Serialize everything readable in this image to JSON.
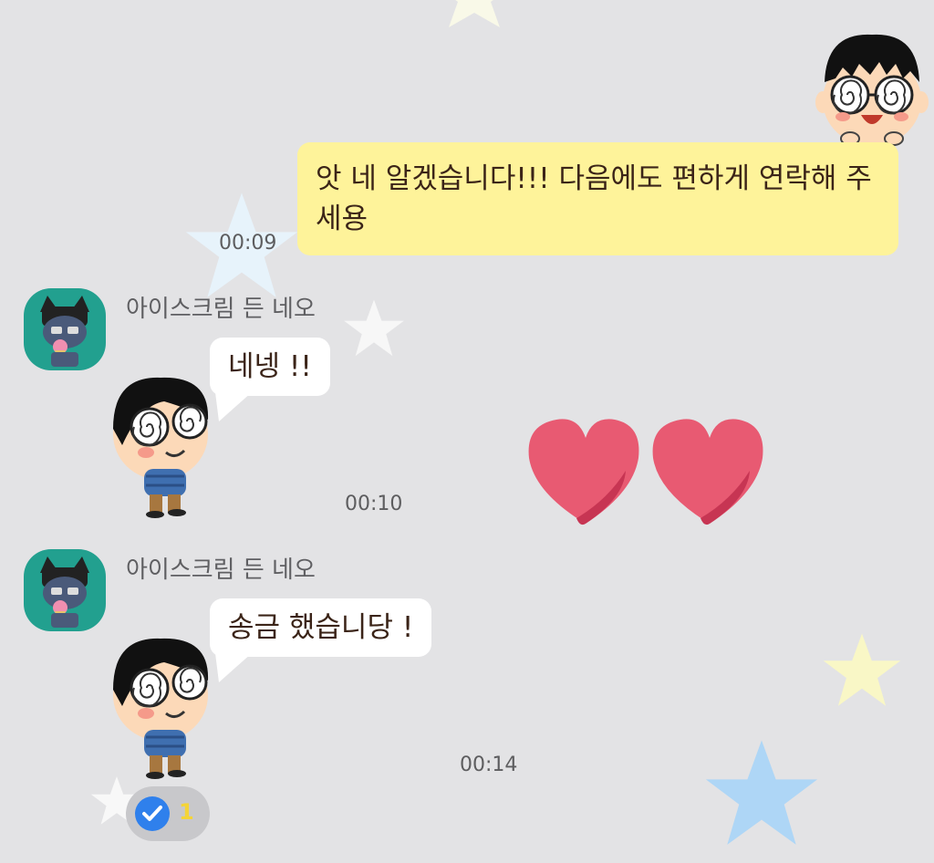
{
  "messages": {
    "outgoing": {
      "text": "앗 네 알겠습니다!!! 다음에도 편하게 연락해 주세용",
      "time": "00:09",
      "emoticon_icon": "spiral-glasses-boy-icon"
    },
    "incoming": [
      {
        "sender": "아이스크림 든 네오",
        "avatar_icon": "neo-cat-with-icecream-icon",
        "text": "네넹 !!",
        "time": "00:10",
        "emoticon_icon": "spiral-glasses-boy-icon"
      },
      {
        "sender": "아이스크림 든 네오",
        "avatar_icon": "neo-cat-with-icecream-icon",
        "text": "송금 했습니당 !",
        "time": "00:14",
        "emoticon_icon": "spiral-glasses-boy-icon"
      }
    ]
  },
  "floating_emoticon": {
    "icon": "two-hearts-icon",
    "color": "#e85a72"
  },
  "read_receipt": {
    "icon": "blue-check-icon",
    "count": "1",
    "check_color": "#2f80ec",
    "count_color": "#f4d437"
  },
  "colors": {
    "background": "#e3e3e5",
    "my_bubble": "#fef39a",
    "their_bubble": "#ffffff",
    "avatar_bg": "#22a08f"
  }
}
